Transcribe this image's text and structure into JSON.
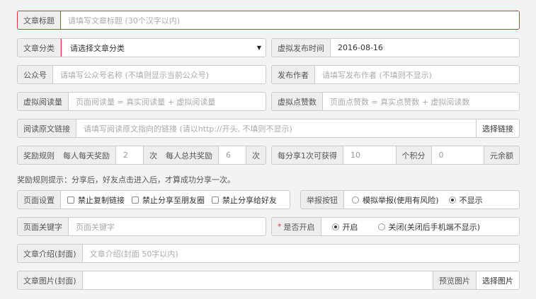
{
  "title": {
    "label": "文章标题",
    "placeholder": "请填写文章标题 (30个汉字以内)"
  },
  "category": {
    "label": "文章分类",
    "value": "请选择文章分类"
  },
  "publish_time": {
    "label": "虚拟发布时间",
    "value": "2016-08-16"
  },
  "account": {
    "label": "公众号",
    "placeholder": "请填写公众号名称 (不填则显示当前公众号)"
  },
  "author": {
    "label": "发布作者",
    "placeholder": "请填写发布作者 (不填则不显示)"
  },
  "virtual_reads": {
    "label": "虚拟阅读量",
    "placeholder": "页面阅读量 = 真实阅读量 + 虚拟阅读量"
  },
  "virtual_likes": {
    "label": "虚拟点赞数",
    "placeholder": "页面点赞数 = 真实点赞数 + 虚拟阅读数"
  },
  "source_link": {
    "label": "阅读原文链接",
    "placeholder": "请填写阅读原文指向的链接 (请以http://开头, 不填则不显示)",
    "button": "选择链接"
  },
  "reward_rule": {
    "label": "奖励规则",
    "daily_label": "每人每天奖励",
    "daily_value": "2",
    "daily_unit": "次",
    "total_label": "每人总共奖励",
    "total_value": "6",
    "total_unit": "次"
  },
  "share_reward": {
    "label": "每分享1次可获得",
    "points_value": "10",
    "points_unit": "个积分",
    "balance_value": "0",
    "balance_unit": "元余额"
  },
  "hint": "奖励规则提示：分享后，好友点击进入后，才算成功分享一次。",
  "page_settings": {
    "label": "页面设置",
    "options": [
      "禁止复制链接",
      "禁止分享至朋友圈",
      "禁止分享给好友"
    ]
  },
  "report_button": {
    "label": "举报按钮",
    "options": [
      "模拟举报(使用有风险)",
      "不显示"
    ]
  },
  "keywords": {
    "label": "页面关键字",
    "placeholder": "页面关键字"
  },
  "enabled": {
    "required_mark": "*",
    "label": "是否开启",
    "options": [
      "开启",
      "关闭(关闭后手机端不显示)"
    ]
  },
  "intro": {
    "label": "文章介绍(封面)",
    "placeholder": "文章介绍(封面 50字以内)"
  },
  "cover_image": {
    "label": "文章图片(封面)",
    "preview_button": "预览图片",
    "select_button": "选择图片"
  }
}
